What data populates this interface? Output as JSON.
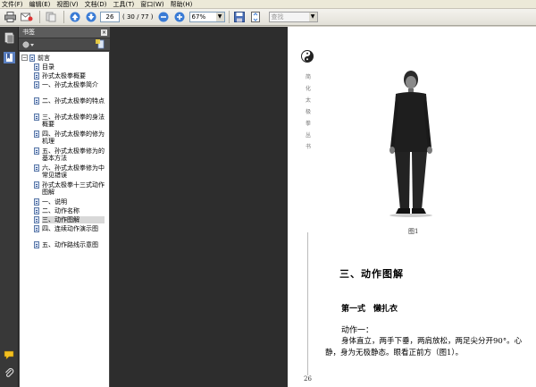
{
  "menu": [
    "文件(F)",
    "编辑(E)",
    "视图(V)",
    "文档(D)",
    "工具(T)",
    "窗口(W)",
    "帮助(H)"
  ],
  "toolbar": {
    "current_page": "26",
    "page_total": "( 30 / 77 )",
    "zoom": "67%",
    "search_placeholder": "查找"
  },
  "panel": {
    "title": "书签",
    "close": "×"
  },
  "bookmarks": [
    {
      "label": "前言",
      "level": 0,
      "collapse": "−"
    },
    {
      "label": "目录",
      "level": 1
    },
    {
      "label": "孙式太极拳概要",
      "level": 1
    },
    {
      "label": "一、孙式太极拳简介",
      "level": 1
    },
    {
      "label": "二、孙式太极拳的特点",
      "level": 1
    },
    {
      "label": "三、孙式太极拳的身法概要",
      "level": 1
    },
    {
      "label": "四、孙式太极拳的修为机理",
      "level": 1
    },
    {
      "label": "五、孙式太极拳修为的基本方法",
      "level": 1
    },
    {
      "label": "六、孙式太极拳修为中常见错误",
      "level": 1
    },
    {
      "label": "孙式太极拳十三式动作图解",
      "level": 1
    },
    {
      "label": "一、说明",
      "level": 1
    },
    {
      "label": "二、动作名称",
      "level": 1
    },
    {
      "label": "三、动作图解",
      "level": 1,
      "selected": true
    },
    {
      "label": "四、连续动作演示图",
      "level": 1
    },
    {
      "label": "五、动作路线示意图",
      "level": 1
    }
  ],
  "document": {
    "vertical_series": "简化太极拳丛书",
    "caption": "图1",
    "section_title": "三、动作图解",
    "style_title": "第一式　懒扎衣",
    "move_label": "动作一：",
    "body": "身体直立，两手下垂，两肩放松，两足尖分开90°。心静，身为无极静态。眼看正前方（图1）。",
    "page_number": "26"
  }
}
